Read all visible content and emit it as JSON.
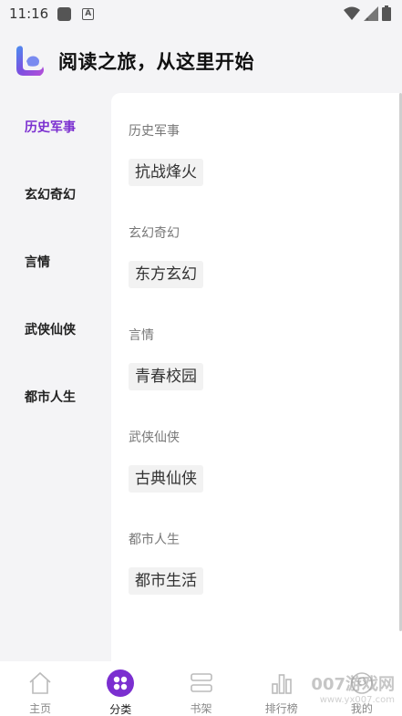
{
  "status": {
    "time": "11:16"
  },
  "header": {
    "title": "阅读之旅，从这里开始"
  },
  "sidebar": {
    "items": [
      {
        "label": "历史军事",
        "active": true
      },
      {
        "label": "玄幻奇幻",
        "active": false
      },
      {
        "label": "言情",
        "active": false
      },
      {
        "label": "武侠仙侠",
        "active": false
      },
      {
        "label": "都市人生",
        "active": false
      }
    ]
  },
  "sections": [
    {
      "title": "历史军事",
      "tags": [
        "抗战烽火"
      ]
    },
    {
      "title": "玄幻奇幻",
      "tags": [
        "东方玄幻"
      ]
    },
    {
      "title": "言情",
      "tags": [
        "青春校园"
      ]
    },
    {
      "title": "武侠仙侠",
      "tags": [
        "古典仙侠"
      ]
    },
    {
      "title": "都市人生",
      "tags": [
        "都市生活"
      ]
    }
  ],
  "tabbar": {
    "tabs": [
      {
        "label": "主页",
        "icon": "home-icon"
      },
      {
        "label": "分类",
        "icon": "category-icon",
        "active": true
      },
      {
        "label": "书架",
        "icon": "bookshelf-icon"
      },
      {
        "label": "排行榜",
        "icon": "ranking-icon"
      },
      {
        "label": "我的",
        "icon": "profile-icon"
      }
    ]
  },
  "watermark": {
    "main": "007游戏网",
    "sub": "www.yx007.com"
  },
  "colors": {
    "accent": "#7b2fd0",
    "background": "#f4f4f6"
  }
}
